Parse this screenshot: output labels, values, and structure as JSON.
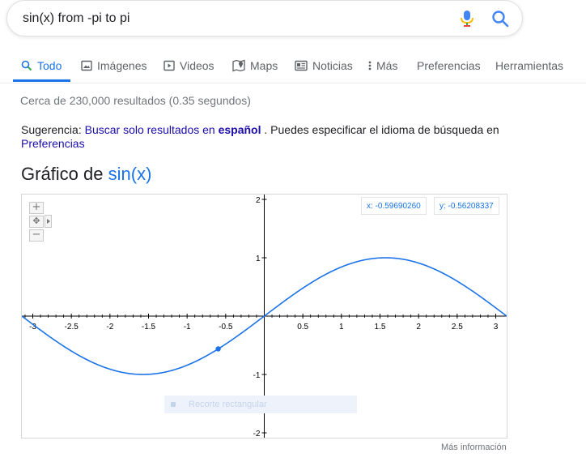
{
  "search": {
    "query": "sin(x) from -pi to pi"
  },
  "tabs": [
    {
      "label": "Todo",
      "icon": "search-icon",
      "active": true
    },
    {
      "label": "Imágenes",
      "icon": "image-icon"
    },
    {
      "label": "Videos",
      "icon": "video-icon"
    },
    {
      "label": "Maps",
      "icon": "map-pin-icon"
    },
    {
      "label": "Noticias",
      "icon": "news-icon"
    },
    {
      "label": "Más",
      "icon": "more-vert-icon"
    },
    {
      "label": "Preferencias"
    },
    {
      "label": "Herramientas"
    }
  ],
  "result_stats": "Cerca de 230,000 resultados (0.35 segundos)",
  "suggestion": {
    "prefix": "Sugerencia:",
    "link_text": "Buscar solo resultados en",
    "link_bold": "español",
    "middle": ". Puedes especificar el idioma de búsqueda en",
    "pref_link": "Preferencias"
  },
  "graph": {
    "title_prefix": "Gráfico de",
    "function_label": "sin(x)",
    "coord_x": "x: -0.59690260",
    "coord_y": "y: -0.56208337",
    "faint_tool": "Recorte rectangular",
    "more_info": "Más información",
    "zoom_in": "+",
    "zoom_out": "−"
  },
  "colors": {
    "accent": "#1a73e8",
    "link": "#1a0dab",
    "curve": "#1a73e8"
  },
  "chart_data": {
    "type": "line",
    "function": "sin(x)",
    "xlim": [
      -3.14159,
      3.14159
    ],
    "ylim": [
      -2,
      2
    ],
    "x_ticks": [
      -3,
      -2.5,
      -2,
      -1.5,
      -1,
      -0.5,
      0.5,
      1,
      1.5,
      2,
      2.5,
      3
    ],
    "x_tick_labels": [
      "-3",
      "-2.5",
      "-2",
      "-1.5",
      "-1",
      "-0.5",
      "0.5",
      "1",
      "1.5",
      "2",
      "2.5",
      "3"
    ],
    "y_ticks": [
      2,
      1,
      -1,
      -2
    ],
    "y_tick_labels": [
      "2",
      "1",
      "-1",
      "-2"
    ],
    "highlight_point": {
      "x": -0.5969026,
      "y": -0.56208337
    },
    "grid": false
  }
}
